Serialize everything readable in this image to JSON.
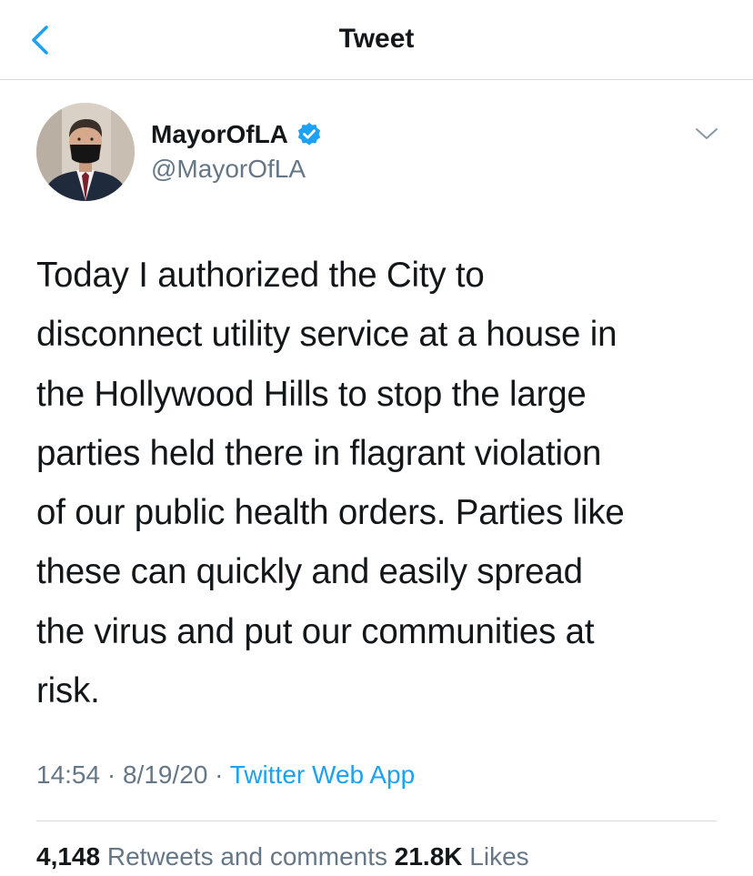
{
  "header": {
    "title": "Tweet",
    "back_icon": "chevron-left-icon",
    "accent_color": "#1da1f2"
  },
  "author": {
    "display_name": "MayorOfLA",
    "handle": "@MayorOfLA",
    "verified": true,
    "verified_icon": "verified-badge-icon",
    "menu_icon": "chevron-down-icon"
  },
  "tweet": {
    "lines": [
      "Today I authorized the City to",
      "disconnect utility service at a house in",
      "the Hollywood Hills to stop the large",
      "parties held there in flagrant violation",
      "of our public health orders. Parties like",
      "these can quickly and easily spread",
      "the virus and put our communities at",
      "risk."
    ],
    "time": "14:54",
    "separator": "·",
    "date": "8/19/20",
    "source": "Twitter Web App"
  },
  "stats": {
    "retweets_count": "4,148",
    "retweets_label": "Retweets and comments",
    "likes_count": "21.8K",
    "likes_label": "Likes"
  }
}
